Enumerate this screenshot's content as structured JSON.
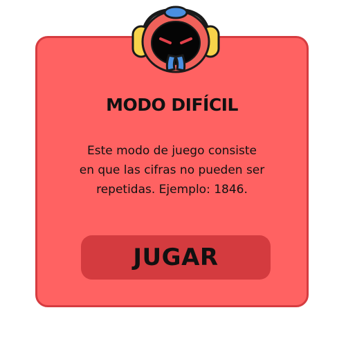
{
  "dialog": {
    "title": "MODO DIFÍCIL",
    "description_lines": [
      "Este modo de juego consiste",
      "en que las cifras no pueden ser",
      "repetidas. Ejemplo: 1846."
    ],
    "play_label": "JUGAR"
  },
  "icons": {
    "mascot": "robot-mascot-icon"
  },
  "colors": {
    "card_background": "#ff6262",
    "card_border": "#d63c40",
    "button_background": "#d43b3f",
    "text": "#111111"
  }
}
